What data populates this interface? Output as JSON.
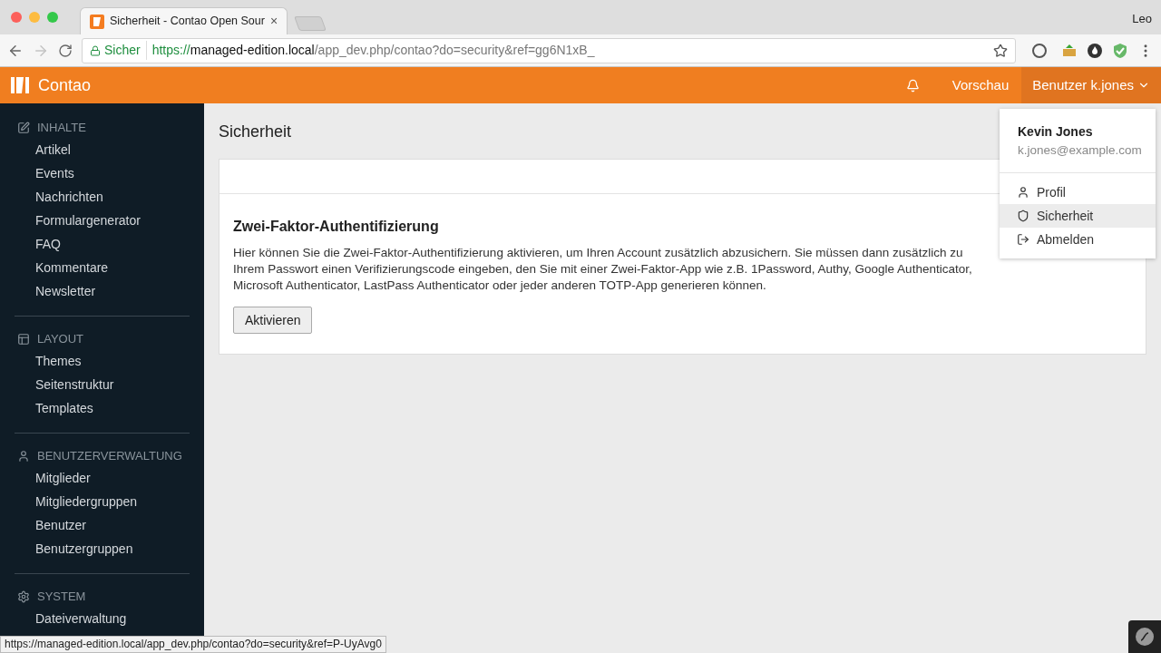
{
  "browser": {
    "tab_title": "Sicherheit - Contao Open Sour",
    "tab_close": "×",
    "profile": "Leo",
    "secure_label": "Sicher",
    "url_scheme": "https://",
    "url_host": "managed-edition.local",
    "url_path": "/app_dev.php/contao?do=security&ref=gg6N1xB_",
    "status_url": "https://managed-edition.local/app_dev.php/contao?do=security&ref=P-UyAvg0"
  },
  "header": {
    "brand": "Contao",
    "preview": "Vorschau",
    "user_menu": "Benutzer k.jones"
  },
  "sidebar": [
    {
      "title": "INHALTE",
      "items": [
        "Artikel",
        "Events",
        "Nachrichten",
        "Formulargenerator",
        "FAQ",
        "Kommentare",
        "Newsletter"
      ]
    },
    {
      "title": "LAYOUT",
      "items": [
        "Themes",
        "Seitenstruktur",
        "Templates"
      ]
    },
    {
      "title": "BENUTZERVERWALTUNG",
      "items": [
        "Mitglieder",
        "Mitgliedergruppen",
        "Benutzer",
        "Benutzergruppen"
      ]
    },
    {
      "title": "SYSTEM",
      "items": [
        "Dateiverwaltung"
      ]
    }
  ],
  "page": {
    "title": "Sicherheit",
    "section_title": "Zwei-Faktor-Authentifizierung",
    "description": "Hier können Sie die Zwei-Faktor-Authentifizierung aktivieren, um Ihren Account zusätzlich abzusichern. Sie müssen dann zusätzlich zu Ihrem Passwort einen Verifizierungscode eingeben, den Sie mit einer Zwei-Faktor-App wie z.B. 1Password, Authy, Google Authenticator, Microsoft Authenticator, LastPass Authenticator oder jeder anderen TOTP-App generieren können.",
    "button": "Aktivieren"
  },
  "user_dropdown": {
    "name": "Kevin Jones",
    "email": "k.jones@example.com",
    "items": [
      {
        "label": "Profil",
        "selected": false
      },
      {
        "label": "Sicherheit",
        "selected": true
      },
      {
        "label": "Abmelden",
        "selected": false
      }
    ]
  }
}
